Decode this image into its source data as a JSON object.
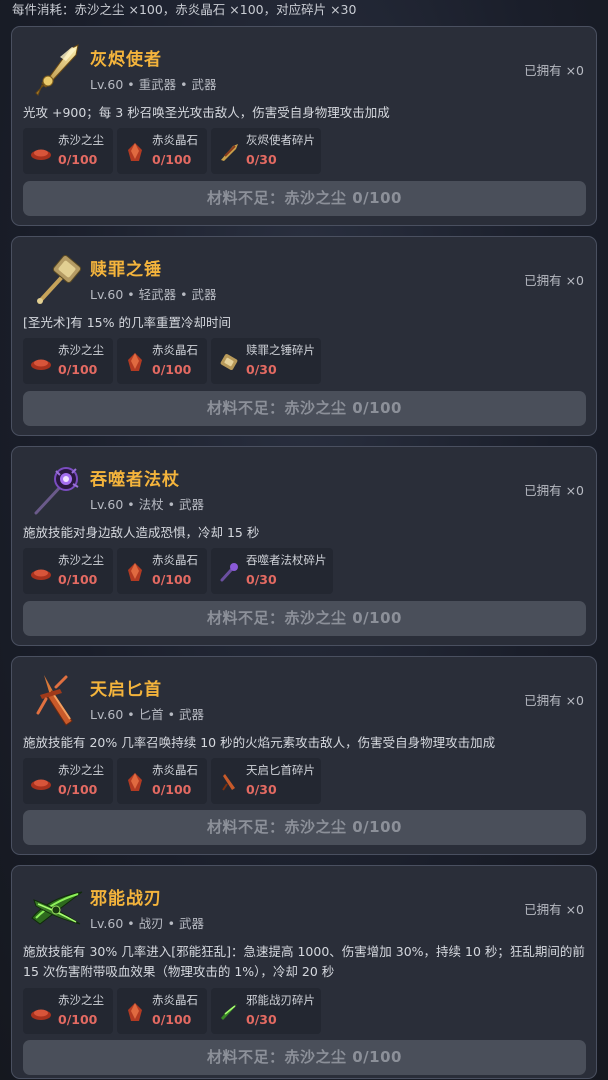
{
  "header": {
    "cost_text": "每件消耗：赤沙之尘 ×100，赤炎晶石 ×100，对应碎片 ×30"
  },
  "weapons": [
    {
      "name": "灰烬使者",
      "level": "Lv.60",
      "type": "重武器",
      "category": "武器",
      "owned": "已拥有 ×0",
      "desc": "光攻 +900；每 3 秒召唤圣光攻击敌人，伤害受自身物理攻击加成",
      "materials": [
        {
          "name": "赤沙之尘",
          "count": "0/100",
          "icon": "red-sand-icon"
        },
        {
          "name": "赤炎晶石",
          "count": "0/100",
          "icon": "red-crystal-icon"
        },
        {
          "name": "灰烬使者碎片",
          "count": "0/30",
          "icon": "ashbringer-shard-icon"
        }
      ],
      "button": "材料不足：赤沙之尘 0/100"
    },
    {
      "name": "赎罪之锤",
      "level": "Lv.60",
      "type": "轻武器",
      "category": "武器",
      "owned": "已拥有 ×0",
      "desc": "[圣光术]有 15% 的几率重置冷却时间",
      "materials": [
        {
          "name": "赤沙之尘",
          "count": "0/100",
          "icon": "red-sand-icon"
        },
        {
          "name": "赤炎晶石",
          "count": "0/100",
          "icon": "red-crystal-icon"
        },
        {
          "name": "赎罪之锤碎片",
          "count": "0/30",
          "icon": "hammer-shard-icon"
        }
      ],
      "button": "材料不足：赤沙之尘 0/100"
    },
    {
      "name": "吞噬者法杖",
      "level": "Lv.60",
      "type": "法杖",
      "category": "武器",
      "owned": "已拥有 ×0",
      "desc": "施放技能对身边敌人造成恐惧，冷却 15 秒",
      "materials": [
        {
          "name": "赤沙之尘",
          "count": "0/100",
          "icon": "red-sand-icon"
        },
        {
          "name": "赤炎晶石",
          "count": "0/100",
          "icon": "red-crystal-icon"
        },
        {
          "name": "吞噬者法杖碎片",
          "count": "0/30",
          "icon": "staff-shard-icon"
        }
      ],
      "button": "材料不足：赤沙之尘 0/100"
    },
    {
      "name": "天启匕首",
      "level": "Lv.60",
      "type": "匕首",
      "category": "武器",
      "owned": "已拥有 ×0",
      "desc": "施放技能有 20% 几率召唤持续 10 秒的火焰元素攻击敌人，伤害受自身物理攻击加成",
      "materials": [
        {
          "name": "赤沙之尘",
          "count": "0/100",
          "icon": "red-sand-icon"
        },
        {
          "name": "赤炎晶石",
          "count": "0/100",
          "icon": "red-crystal-icon"
        },
        {
          "name": "天启匕首碎片",
          "count": "0/30",
          "icon": "dagger-shard-icon"
        }
      ],
      "button": "材料不足：赤沙之尘 0/100"
    },
    {
      "name": "邪能战刃",
      "level": "Lv.60",
      "type": "战刃",
      "category": "武器",
      "owned": "已拥有 ×0",
      "desc": "施放技能有 30% 几率进入[邪能狂乱]：急速提高 1000、伤害增加 30%，持续 10 秒；狂乱期间的前 15 次伤害附带吸血效果（物理攻击的 1%），冷却 20 秒",
      "materials": [
        {
          "name": "赤沙之尘",
          "count": "0/100",
          "icon": "red-sand-icon"
        },
        {
          "name": "赤炎晶石",
          "count": "0/100",
          "icon": "red-crystal-icon"
        },
        {
          "name": "邪能战刃碎片",
          "count": "0/30",
          "icon": "warglaive-shard-icon"
        }
      ],
      "button": "材料不足：赤沙之尘 0/100"
    }
  ]
}
